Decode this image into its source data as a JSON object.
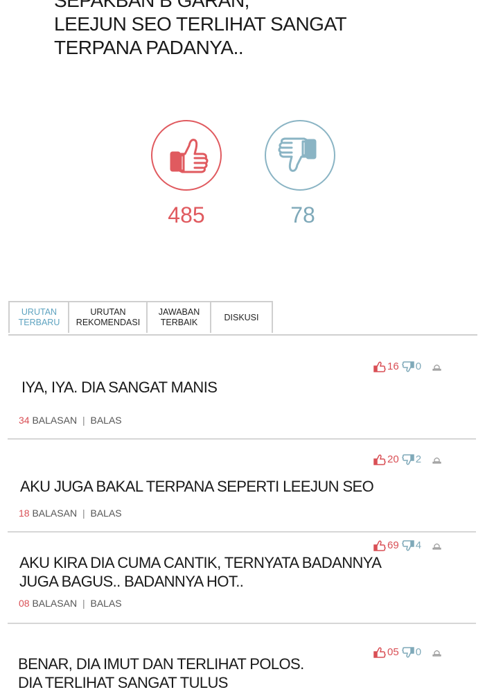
{
  "caption": {
    "lines": [
      "SEPAKBAN B GARAN,",
      "LEEJUN SEO TERLIHAT SANGAT",
      "TERPANA PADANYA.."
    ]
  },
  "votes": {
    "like_count": "485",
    "dislike_count": "78",
    "like_icon": "thumbs-up-icon",
    "dislike_icon": "thumbs-down-icon",
    "like_color": "#e05a5f",
    "dislike_color": "#8ab4c4"
  },
  "tabs": [
    {
      "label": "URUTAN\nTERBARU",
      "active": true
    },
    {
      "label": "URUTAN\nREKOMENDASI",
      "active": false
    },
    {
      "label": "JAWABAN\nTERBAIK",
      "active": false
    },
    {
      "label": "DISKUSI",
      "active": false
    }
  ],
  "comments": [
    {
      "text_lines": [
        "IYA, IYA. DIA SANGAT MANIS"
      ],
      "likes": "16",
      "dislikes": "0",
      "reply_count": "34",
      "replies_label": "BALASAN",
      "reply_action": "BALAS"
    },
    {
      "text_lines": [
        "AKU JUGA BAKAL TERPANA SEPERTI LEEJUN SEO"
      ],
      "likes": "20",
      "dislikes": "2",
      "reply_count": "18",
      "replies_label": "BALASAN",
      "reply_action": "BALAS"
    },
    {
      "text_lines": [
        "AKU KIRA DIA CUMA CANTIK, TERNYATA BADANNYA",
        "JUGA BAGUS.. BADANNYA HOT.."
      ],
      "likes": "69",
      "dislikes": "4",
      "reply_count": "08",
      "replies_label": "BALASAN",
      "reply_action": "BALAS"
    },
    {
      "text_lines": [
        "BENAR, DIA IMUT DAN TERLIHAT POLOS.",
        "DIA TERLIHAT SANGAT TULUS"
      ],
      "likes": "05",
      "dislikes": "0"
    }
  ]
}
